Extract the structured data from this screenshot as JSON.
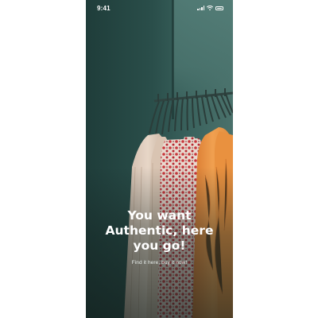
{
  "status_bar": {
    "time": "9:41",
    "icons": [
      "signal-icon",
      "wifi-icon",
      "battery-icon"
    ]
  },
  "hero": {
    "background_description_colors": {
      "wall": "#2a4e4a",
      "wall_light": "#56807a"
    }
  },
  "onboarding": {
    "headline": "You want Authentic, here you go!",
    "subtitle": "Find it here, buy it now!"
  },
  "colors": {
    "text_primary": "#ffffff",
    "text_secondary": "#e6ecea"
  }
}
